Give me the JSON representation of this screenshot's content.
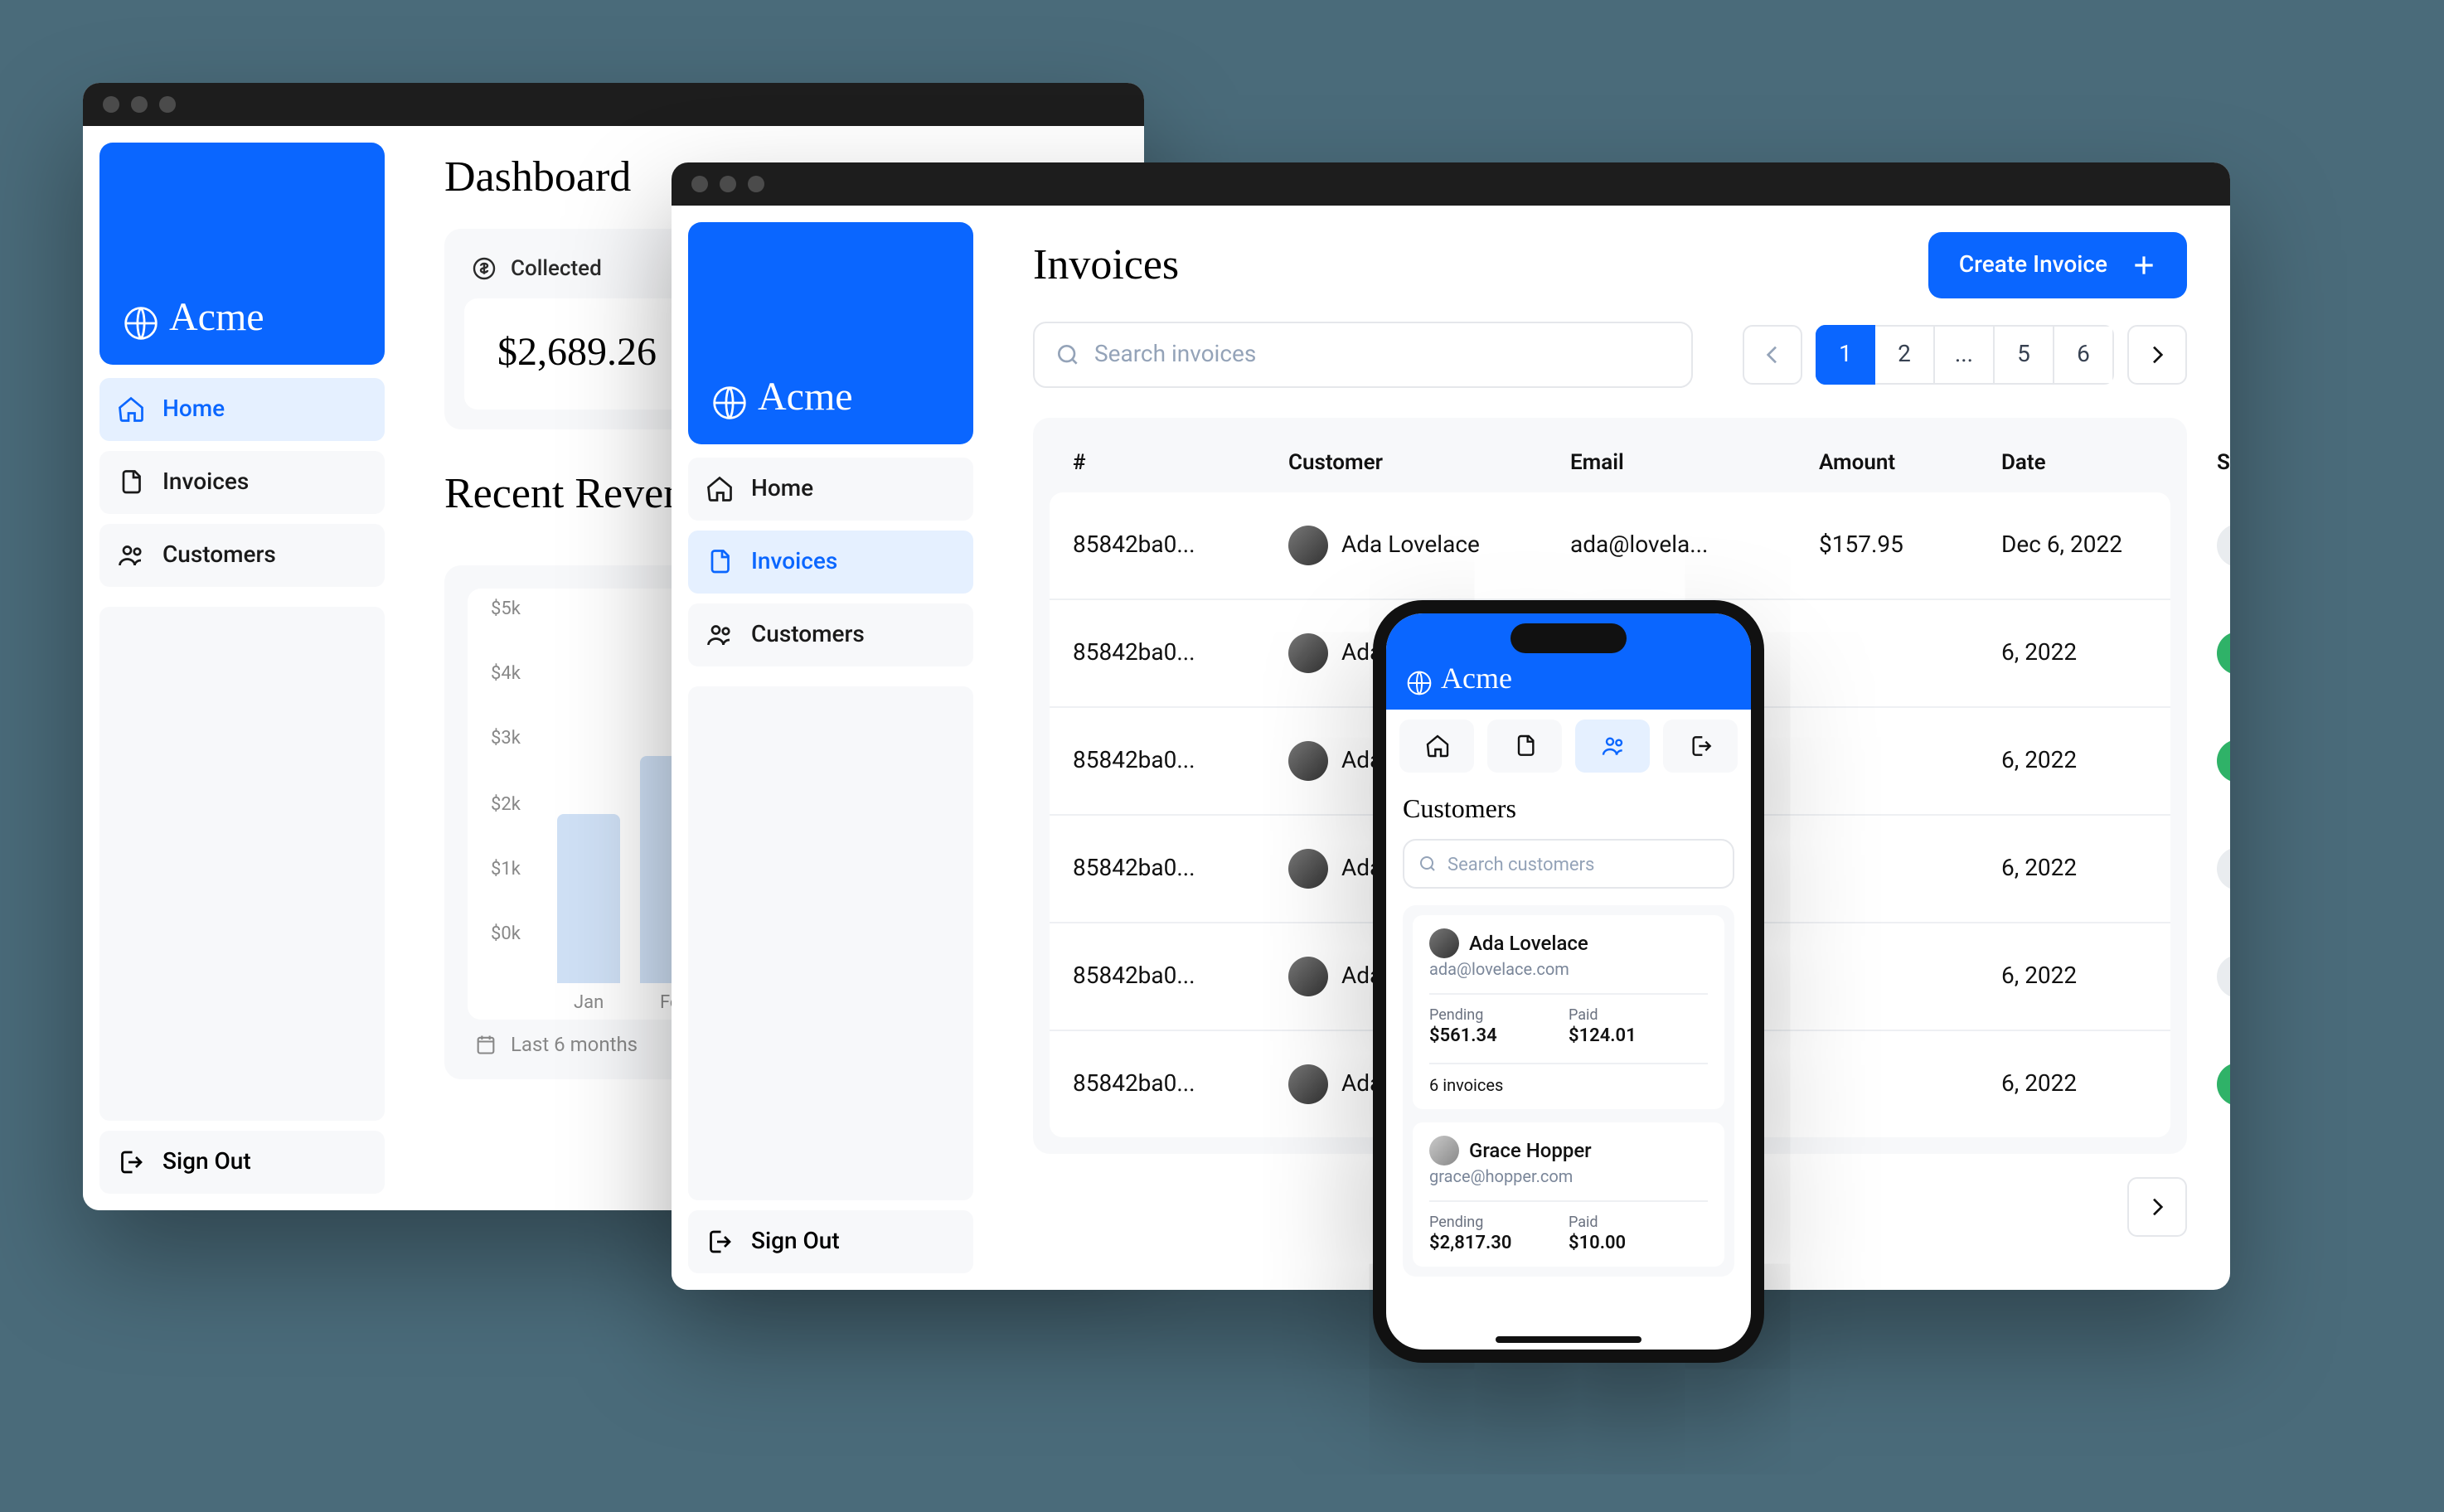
{
  "brand": {
    "name": "Acme"
  },
  "dashboard": {
    "title": "Dashboard",
    "collected_label": "Collected",
    "collected_value": "$2,689.26",
    "recent_title": "Recent Revenue",
    "y_ticks": [
      "$5k",
      "$4k",
      "$3k",
      "$2k",
      "$1k",
      "$0k"
    ],
    "footer": "Last 6 months"
  },
  "chart_data": {
    "type": "bar",
    "title": "Recent Revenue",
    "categories": [
      "Jan",
      "Feb"
    ],
    "values": [
      2600,
      3500
    ],
    "ylabel": "",
    "ylim": [
      0,
      5000
    ],
    "y_ticks": [
      0,
      1000,
      2000,
      3000,
      4000,
      5000
    ]
  },
  "invoices": {
    "title": "Invoices",
    "create_label": "Create Invoice",
    "search_placeholder": "Search invoices",
    "pagination": {
      "pages": [
        "1",
        "2",
        "...",
        "5",
        "6"
      ],
      "active": "1"
    },
    "columns": {
      "id": "#",
      "customer": "Customer",
      "email": "Email",
      "amount": "Amount",
      "date": "Date",
      "status": "Status"
    },
    "status_labels": {
      "pending": "Pending",
      "paid": "Paid"
    },
    "rows": [
      {
        "id": "85842ba0...",
        "customer": "Ada Lovelace",
        "email": "ada@lovela...",
        "amount": "$157.95",
        "date_full": "Dec 6, 2022",
        "date_right": "6, 2022",
        "status": "pending",
        "cust_display": "Ada Lovelace"
      },
      {
        "id": "85842ba0...",
        "customer": "Ada Lovelace",
        "email": "",
        "amount": "",
        "date_full": "",
        "date_right": "6, 2022",
        "status": "paid",
        "cust_display": "Ada Lovela..."
      },
      {
        "id": "85842ba0...",
        "customer": "Ada Lovelace",
        "email": "",
        "amount": "",
        "date_full": "",
        "date_right": "6, 2022",
        "status": "paid",
        "cust_display": "Ada Lovela..."
      },
      {
        "id": "85842ba0...",
        "customer": "Ada Lovelace",
        "email": "",
        "amount": "",
        "date_full": "",
        "date_right": "6, 2022",
        "status": "pending",
        "cust_display": "Ada Lovela..."
      },
      {
        "id": "85842ba0...",
        "customer": "Ada Lovelace",
        "email": "",
        "amount": "",
        "date_full": "",
        "date_right": "6, 2022",
        "status": "pending",
        "cust_display": "Ada Lovela..."
      },
      {
        "id": "85842ba0...",
        "customer": "Ada Lovelace",
        "email": "",
        "amount": "",
        "date_full": "",
        "date_right": "6, 2022",
        "status": "paid",
        "cust_display": "Ada Lovela..."
      }
    ]
  },
  "sidebar": {
    "items": [
      {
        "key": "home",
        "label": "Home"
      },
      {
        "key": "invoices",
        "label": "Invoices"
      },
      {
        "key": "customers",
        "label": "Customers"
      }
    ],
    "signout": "Sign Out"
  },
  "mobile": {
    "title": "Customers",
    "search_placeholder": "Search customers",
    "stat_labels": {
      "pending": "Pending",
      "paid": "Paid"
    },
    "invoices_suffix": "invoices",
    "customers": [
      {
        "name": "Ada Lovelace",
        "email": "ada@lovelace.com",
        "pending": "$561.34",
        "paid": "$124.01",
        "invoices": "6"
      },
      {
        "name": "Grace Hopper",
        "email": "grace@hopper.com",
        "pending": "$2,817.30",
        "paid": "$10.00",
        "invoices": ""
      }
    ]
  }
}
